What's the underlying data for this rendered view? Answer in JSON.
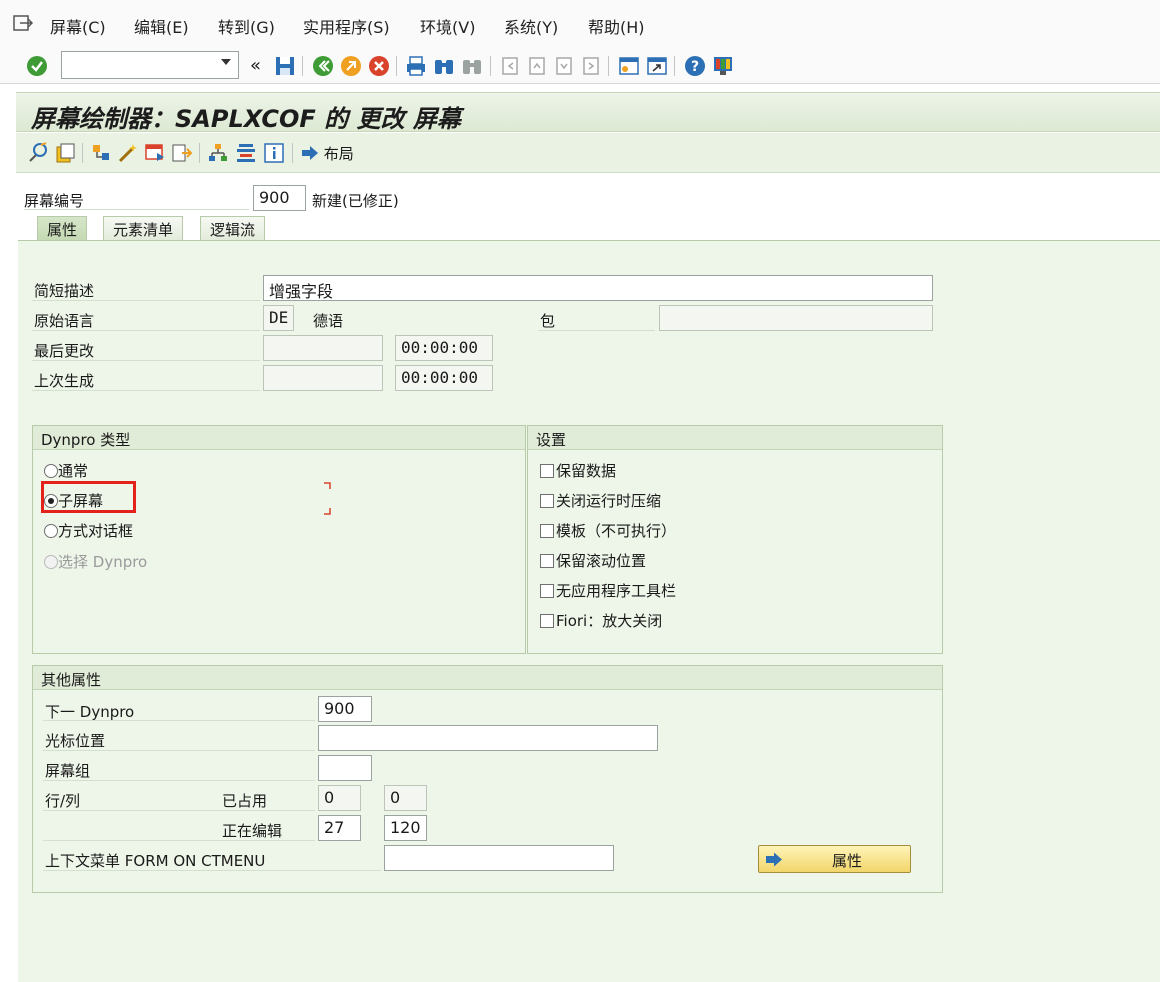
{
  "menu": {
    "items": [
      "屏幕(C)",
      "编辑(E)",
      "转到(G)",
      "实用程序(S)",
      "环境(V)",
      "系统(Y)",
      "帮助(H)"
    ],
    "icon": "exit-icon"
  },
  "toolbar": {
    "command_value": "",
    "collapse_symbol": "«",
    "icons": [
      "check-icon",
      "save-icon",
      "back-icon",
      "exit-icon",
      "cancel-icon",
      "print-icon",
      "find-icon",
      "find-next-icon",
      "first-page-icon",
      "previous-page-icon",
      "next-page-icon",
      "last-page-icon",
      "new-session-icon",
      "shortcut-icon",
      "help-icon",
      "customize-layout-icon"
    ]
  },
  "title": "屏幕绘制器：SAPLXCOF 的 更改 屏幕",
  "app_toolbar": {
    "icons": [
      "toggle-display-change-icon",
      "other-object-icon",
      "check-icon",
      "activate-icon",
      "test-icon",
      "where-used-icon",
      "hierarchy-icon",
      "align-icon",
      "info-icon"
    ],
    "layout_label": "布局"
  },
  "screen_number": {
    "label": "屏幕编号",
    "value": "900",
    "status": "新建(已修正)"
  },
  "tabs": [
    {
      "label": "属性",
      "active": true
    },
    {
      "label": "元素清单",
      "active": false
    },
    {
      "label": "逻辑流",
      "active": false
    }
  ],
  "attributes": {
    "short_desc": {
      "label": "简短描述",
      "value": "增强字段"
    },
    "orig_lang": {
      "label": "原始语言",
      "code": "DE",
      "name": "德语"
    },
    "package": {
      "label": "包",
      "value": ""
    },
    "last_changed": {
      "label": "最后更改",
      "date": "",
      "time": "00:00:00"
    },
    "last_generated": {
      "label": "上次生成",
      "date": "",
      "time": "00:00:00"
    }
  },
  "dynpro_type": {
    "title": "Dynpro 类型",
    "options": [
      {
        "label": "通常",
        "selected": false,
        "disabled": false
      },
      {
        "label": "子屏幕",
        "selected": true,
        "disabled": false
      },
      {
        "label": "方式对话框",
        "selected": false,
        "disabled": false
      },
      {
        "label": "选择 Dynpro",
        "selected": false,
        "disabled": true
      }
    ]
  },
  "settings": {
    "title": "设置",
    "options": [
      {
        "label": "保留数据",
        "checked": false
      },
      {
        "label": "关闭运行时压缩",
        "checked": false
      },
      {
        "label": "模板（不可执行）",
        "checked": false
      },
      {
        "label": "保留滚动位置",
        "checked": false
      },
      {
        "label": "无应用程序工具栏",
        "checked": false
      },
      {
        "label": "Fiori：放大关闭",
        "checked": false
      }
    ]
  },
  "other": {
    "title": "其他属性",
    "next_dynpro": {
      "label": "下一 Dynpro",
      "value": "900"
    },
    "cursor_pos": {
      "label": "光标位置",
      "value": ""
    },
    "screen_group": {
      "label": "屏幕组",
      "value": ""
    },
    "row_col": {
      "label": "行/列"
    },
    "occupied": {
      "label": "已占用",
      "row": "0",
      "col": "0"
    },
    "editing": {
      "label": "正在编辑",
      "row": "27",
      "col": "120"
    },
    "context_menu": {
      "label": "上下文菜单 FORM ON CTMENU",
      "value": ""
    },
    "attr_button": "属性"
  },
  "colors": {
    "accent_green": "#e1ecd8",
    "highlight_red": "#e3231b",
    "button_yellow": "#f2d66b"
  }
}
